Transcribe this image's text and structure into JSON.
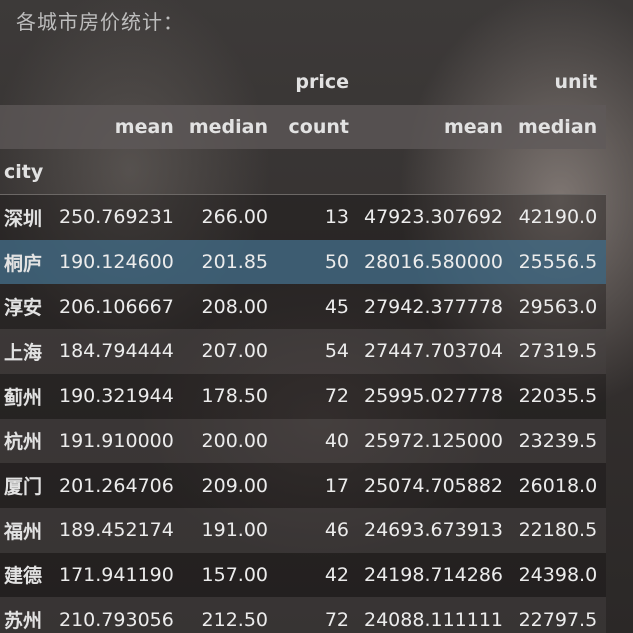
{
  "caption": "各城市房价统计：",
  "header": {
    "level0": [
      "price",
      "unit"
    ],
    "level1": [
      "mean",
      "median",
      "count",
      "mean",
      "median"
    ],
    "index_name": "city"
  },
  "rows": [
    {
      "city": "深圳",
      "price_mean": "250.769231",
      "price_median": "266.00",
      "price_count": "13",
      "unit_mean": "47923.307692",
      "unit_median": "42190.0"
    },
    {
      "city": "桐庐",
      "price_mean": "190.124600",
      "price_median": "201.85",
      "price_count": "50",
      "unit_mean": "28016.580000",
      "unit_median": "25556.5"
    },
    {
      "city": "淳安",
      "price_mean": "206.106667",
      "price_median": "208.00",
      "price_count": "45",
      "unit_mean": "27942.377778",
      "unit_median": "29563.0"
    },
    {
      "city": "上海",
      "price_mean": "184.794444",
      "price_median": "207.00",
      "price_count": "54",
      "unit_mean": "27447.703704",
      "unit_median": "27319.5"
    },
    {
      "city": "蓟州",
      "price_mean": "190.321944",
      "price_median": "178.50",
      "price_count": "72",
      "unit_mean": "25995.027778",
      "unit_median": "22035.5"
    },
    {
      "city": "杭州",
      "price_mean": "191.910000",
      "price_median": "200.00",
      "price_count": "40",
      "unit_mean": "25972.125000",
      "unit_median": "23239.5"
    },
    {
      "city": "厦门",
      "price_mean": "201.264706",
      "price_median": "209.00",
      "price_count": "17",
      "unit_mean": "25074.705882",
      "unit_median": "26018.0"
    },
    {
      "city": "福州",
      "price_mean": "189.452174",
      "price_median": "191.00",
      "price_count": "46",
      "unit_mean": "24693.673913",
      "unit_median": "22180.5"
    },
    {
      "city": "建德",
      "price_mean": "171.941190",
      "price_median": "157.00",
      "price_count": "42",
      "unit_mean": "24198.714286",
      "unit_median": "24398.0"
    },
    {
      "city": "苏州",
      "price_mean": "210.793056",
      "price_median": "212.50",
      "price_count": "72",
      "unit_mean": "24088.111111",
      "unit_median": "22797.5"
    }
  ],
  "selected_row": 1,
  "colors": {
    "selected_row": "#3e647c",
    "text": "#ececec"
  }
}
